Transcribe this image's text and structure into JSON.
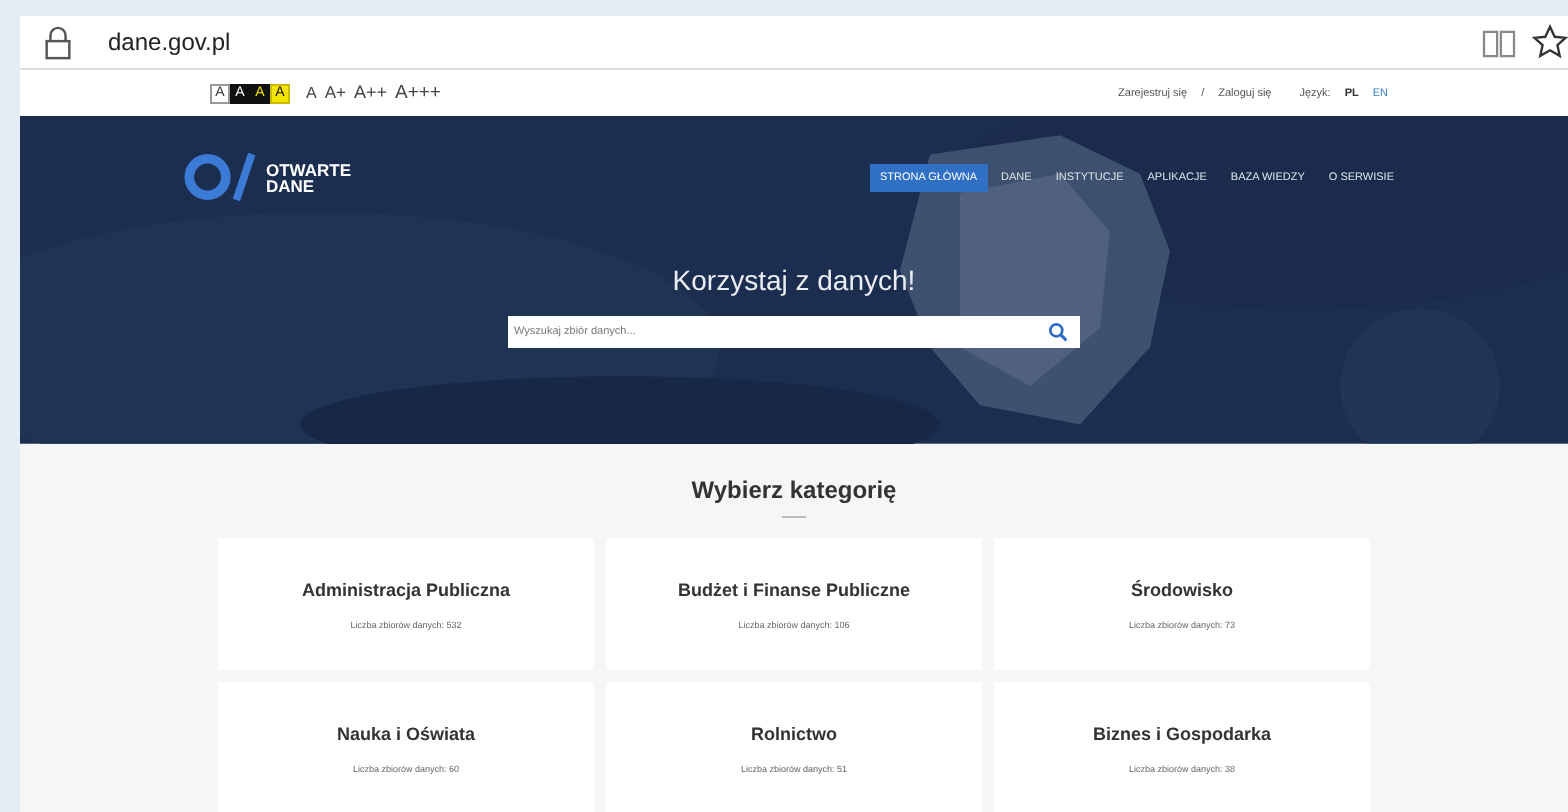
{
  "browser": {
    "url": "dane.gov.pl"
  },
  "accessibility": {
    "contrast_options": [
      {
        "label": "A",
        "kind": "default"
      },
      {
        "label": "A",
        "kind": "dark"
      },
      {
        "label": "A",
        "kind": "dark-yellow"
      },
      {
        "label": "A",
        "kind": "yellow"
      }
    ],
    "font_sizes": [
      "A",
      "A+",
      "A++",
      "A+++"
    ]
  },
  "account_links": [
    "Zarejestruj się",
    "/",
    "Zaloguj się"
  ],
  "language": {
    "label": "Język:",
    "options": [
      {
        "label": "PL",
        "selected": true
      },
      {
        "label": "EN",
        "selected": false
      }
    ]
  },
  "logo": {
    "line1": "OTWARTE",
    "line2": "DANE"
  },
  "nav": [
    {
      "label": "STRONA GŁÓWNA",
      "selected": true
    },
    {
      "label": "DANE",
      "selected": false
    },
    {
      "label": "INSTYTUCJE",
      "selected": false
    },
    {
      "label": "APLIKACJE",
      "selected": false
    },
    {
      "label": "BAZA WIEDZY",
      "selected": false
    },
    {
      "label": "O SERWISIE",
      "selected": false
    }
  ],
  "hero": {
    "title": "Korzystaj z danych!",
    "search": {
      "placeholder": "Wyszukaj zbiór danych..."
    }
  },
  "categories": {
    "title": "Wybierz kategorię",
    "items": [
      {
        "name": "Administracja Publiczna",
        "count": "Liczba zbiorów danych: 532"
      },
      {
        "name": "Budżet i Finanse Publiczne",
        "count": "Liczba zbiorów danych: 106"
      },
      {
        "name": "Środowisko",
        "count": "Liczba zbiorów danych: 73"
      },
      {
        "name": "Nauka i Oświata",
        "count": "Liczba zbiorów danych: 60"
      },
      {
        "name": "Rolnictwo",
        "count": "Liczba zbiorów danych: 51"
      },
      {
        "name": "Biznes i Gospodarka",
        "count": "Liczba zbiorów danych: 38"
      }
    ]
  }
}
